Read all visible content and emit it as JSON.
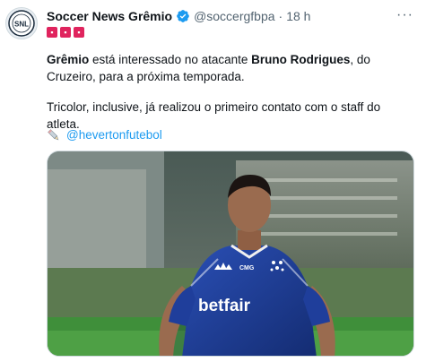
{
  "account": {
    "name": "Soccer News Grêmio",
    "handle": "@soccergfbpa",
    "separator": "·",
    "time": "18 h",
    "flags": [
      "▪",
      "▪",
      "▪"
    ]
  },
  "tweet": {
    "p1_bold1": "Grêmio",
    "p1_text1": " está interessado no atacante ",
    "p1_bold2": "Bruno Rodrigues",
    "p1_text2": ", do Cruzeiro, para a próxima temporada.",
    "p2": "Tricolor, inclusive, já realizou o primeiro contato com o staff do atleta.",
    "link_icon": "pen-icon",
    "link": "@hevertonfutebol"
  },
  "media": {
    "sponsor": "betfair",
    "kit_brand": "adidas",
    "kit_text": "CMG"
  },
  "colors": {
    "link": "#1d9bf0",
    "verified": "#1d9bf0",
    "jersey": "#1f3e9b",
    "pitch": "#3f8f3a"
  }
}
